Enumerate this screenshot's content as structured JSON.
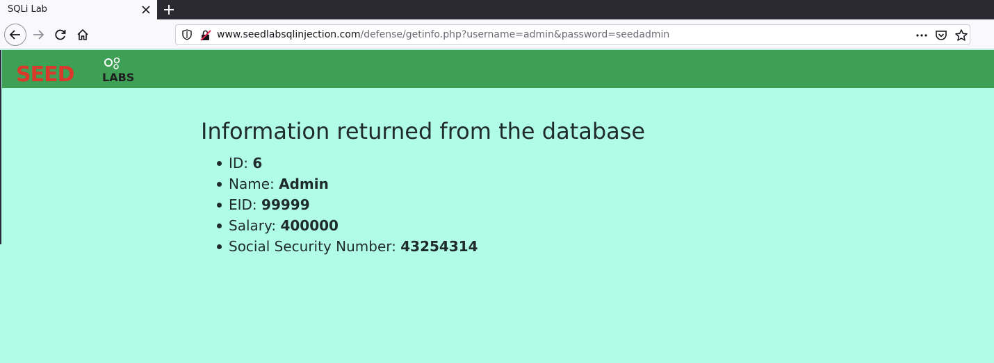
{
  "browser": {
    "tab_title": "SQLi Lab",
    "url_host": "www.seedlabsqlinjection.com",
    "url_path": "/defense/getinfo.php?username=admin&password=seedadmin",
    "icons": [
      "close-icon",
      "plus-icon",
      "back-arrow-icon",
      "forward-arrow-icon",
      "reload-icon",
      "home-icon",
      "shield-icon",
      "insecure-lock-icon",
      "more-icon",
      "pocket-icon",
      "star-icon"
    ]
  },
  "site": {
    "logo_text_main": "SEED",
    "logo_text_sub": "LABS",
    "header_color": "#3ea055",
    "background_color": "#b1fce4"
  },
  "main": {
    "heading": "Information returned from the database",
    "items": [
      {
        "label": "ID: ",
        "value": "6"
      },
      {
        "label": "Name: ",
        "value": "Admin"
      },
      {
        "label": "EID: ",
        "value": "99999"
      },
      {
        "label": "Salary: ",
        "value": "400000"
      },
      {
        "label": "Social Security Number: ",
        "value": "43254314"
      }
    ]
  }
}
